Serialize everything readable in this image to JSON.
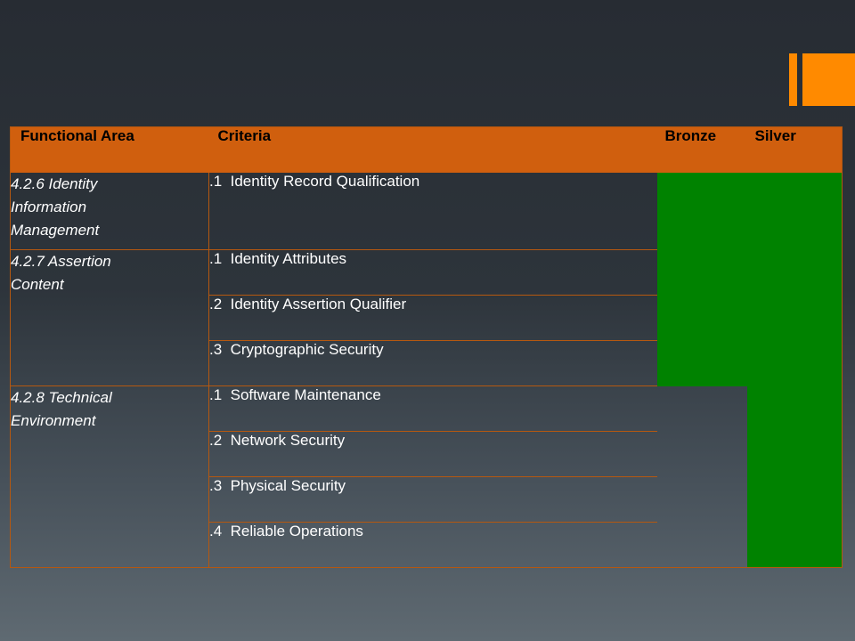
{
  "decor": {
    "accent": "#ff8a00",
    "header_color": "#d05f0e",
    "check_color": "#008200"
  },
  "table": {
    "headers": {
      "functional_area": "Functional Area",
      "criteria": "Criteria",
      "bronze": "Bronze",
      "silver": "Silver"
    },
    "groups": [
      {
        "area_lines": [
          "4.2.6 Identity",
          "Information",
          "Management"
        ],
        "criteria": [
          {
            "label": ".1  Identity Record Qualification",
            "bronze": true,
            "silver": true
          }
        ]
      },
      {
        "area_lines": [
          "4.2.7 Assertion",
          "Content"
        ],
        "criteria": [
          {
            "label": ".1  Identity Attributes",
            "bronze": true,
            "silver": true
          },
          {
            "label": ".2  Identity Assertion Qualifier",
            "bronze": true,
            "silver": true
          },
          {
            "label": ".3  Cryptographic Security",
            "bronze": true,
            "silver": true
          }
        ]
      },
      {
        "area_lines": [
          "4.2.8 Technical",
          "Environment"
        ],
        "criteria": [
          {
            "label": ".1  Software Maintenance",
            "bronze": false,
            "silver": true
          },
          {
            "label": ".2  Network Security",
            "bronze": false,
            "silver": true
          },
          {
            "label": ".3  Physical Security",
            "bronze": false,
            "silver": true
          },
          {
            "label": ".4  Reliable Operations",
            "bronze": false,
            "silver": true
          }
        ]
      }
    ]
  }
}
